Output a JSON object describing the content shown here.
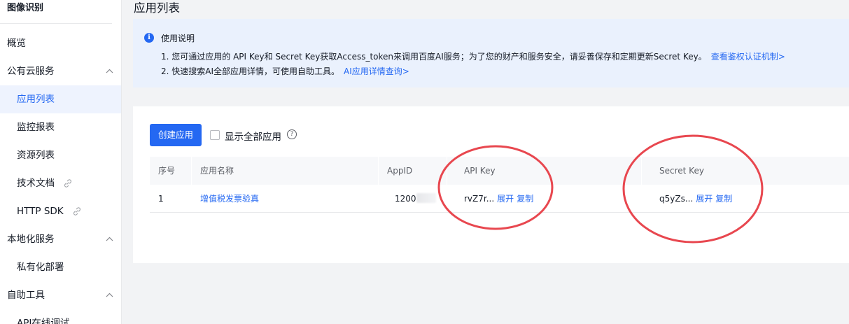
{
  "sidebar": {
    "title": "图像识别",
    "items": [
      {
        "label": "概览"
      },
      {
        "label": "公有云服务"
      },
      {
        "label": "应用列表"
      },
      {
        "label": "监控报表"
      },
      {
        "label": "资源列表"
      },
      {
        "label": "技术文档"
      },
      {
        "label": "HTTP SDK"
      },
      {
        "label": "本地化服务"
      },
      {
        "label": "私有化部署"
      },
      {
        "label": "自助工具"
      },
      {
        "label": "API在线调试"
      }
    ]
  },
  "main": {
    "page_title": "应用列表",
    "notice": {
      "icon": "info-icon",
      "heading": "使用说明",
      "line1": "1. 您可通过应用的 API Key和 Secret Key获取Access_token来调用百度AI服务；为了您的财产和服务安全，请妥善保存和定期更新Secret Key。",
      "line1_link": "查看鉴权认证机制>",
      "line2": "2. 快速搜索AI全部应用详情，可使用自助工具。",
      "line2_link": "AI应用详情查询>"
    },
    "toolbar": {
      "create_label": "创建应用",
      "show_all_label": "显示全部应用",
      "show_all_checked": false
    },
    "table": {
      "columns": [
        "序号",
        "应用名称",
        "AppID",
        "API Key",
        "Secret Key"
      ],
      "rows": [
        {
          "index": "1",
          "name": "增值税发票验真",
          "appid": "1200",
          "api_key": "rvZ7r...",
          "secret_key": "q5yZs...",
          "expand_label": "展开",
          "copy_label": "复制"
        }
      ]
    }
  },
  "colors": {
    "accent": "#2468f2",
    "annotation": "#e8474f"
  }
}
